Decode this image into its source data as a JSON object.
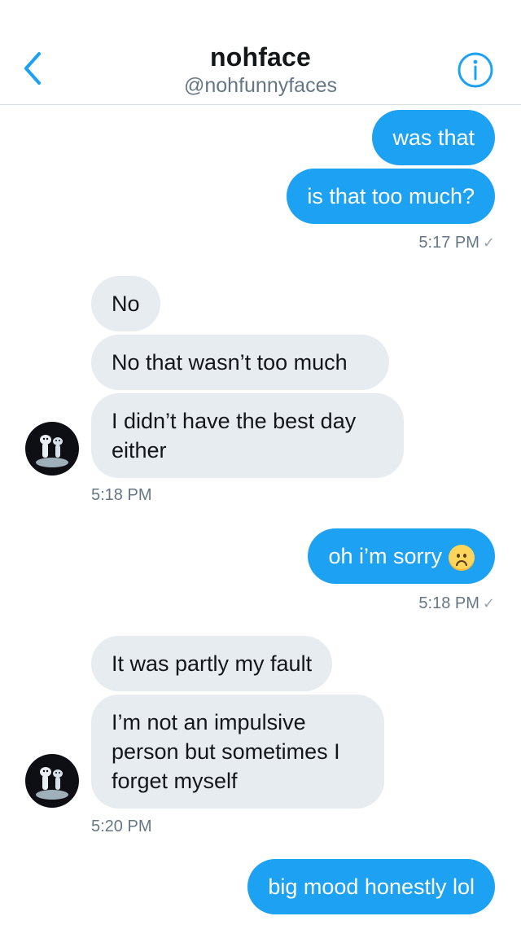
{
  "header": {
    "title": "nohface",
    "handle": "@nohfunnyfaces",
    "back_icon": "chevron-left-icon",
    "info_icon": "info-circle-icon"
  },
  "colors": {
    "accent": "#1da1f2",
    "incoming_bubble": "#e6ecf0",
    "meta_text": "#657786"
  },
  "messages": [
    {
      "direction": "outgoing",
      "text": "was that"
    },
    {
      "direction": "outgoing",
      "text": "is that too much?"
    },
    {
      "direction": "outgoing",
      "timestamp": "5:17 PM",
      "status": "✓"
    },
    {
      "direction": "incoming",
      "text": "No"
    },
    {
      "direction": "incoming",
      "text": "No that wasn’t too much"
    },
    {
      "direction": "incoming",
      "text": "I didn’t have the best day either"
    },
    {
      "direction": "incoming",
      "timestamp": "5:18 PM"
    },
    {
      "direction": "outgoing",
      "text": "oh i’m sorry",
      "emoji": "frowning-face-icon"
    },
    {
      "direction": "outgoing",
      "timestamp": "5:18 PM",
      "status": "✓"
    },
    {
      "direction": "incoming",
      "text": "It was partly my fault"
    },
    {
      "direction": "incoming",
      "text": "I’m not an impulsive person but sometimes I forget myself"
    },
    {
      "direction": "incoming",
      "timestamp": "5:20 PM"
    },
    {
      "direction": "outgoing",
      "text": "big mood honestly lol"
    }
  ]
}
